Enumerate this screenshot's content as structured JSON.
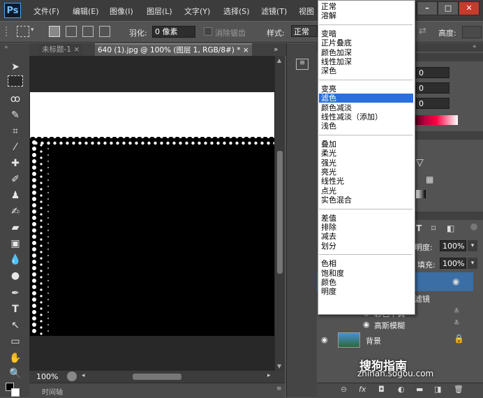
{
  "app": {
    "logo": "Ps"
  },
  "menu": [
    "文件(F)",
    "编辑(E)",
    "图像(I)",
    "图层(L)",
    "文字(Y)",
    "选择(S)",
    "滤镜(T)",
    "视图"
  ],
  "window_controls": {
    "minimize": "–",
    "maximize": "□",
    "close": "✕"
  },
  "options_bar": {
    "feather_label": "羽化:",
    "feather_value": "0 像素",
    "antialias_label": "消除锯齿",
    "style_label": "样式:",
    "style_value": "正常",
    "height_label": "高度:"
  },
  "tabs": [
    {
      "label": "未标题-1",
      "close": "×"
    },
    {
      "label": "640 (1).jpg @ 100% (图层 1, RGB/8#) *",
      "close": "×"
    }
  ],
  "tab_overflow": "»",
  "status": {
    "zoom": "100%"
  },
  "timeline_label": "时间轴",
  "blend_dropdown": {
    "groups": [
      [
        "正常",
        "溶解"
      ],
      [
        "变暗",
        "正片叠底",
        "颜色加深",
        "线性加深",
        "深色"
      ],
      [
        "变亮",
        "滤色",
        "颜色减淡",
        "线性减淡（添加）",
        "浅色"
      ],
      [
        "叠加",
        "柔光",
        "强光",
        "亮光",
        "线性光",
        "点光",
        "实色混合"
      ],
      [
        "差值",
        "排除",
        "减去",
        "划分"
      ],
      [
        "色相",
        "饱和度",
        "颜色",
        "明度"
      ]
    ],
    "selected": "滤色"
  },
  "color_panel": {
    "values": [
      "0",
      "0",
      "0"
    ]
  },
  "layers_panel": {
    "opacity_label": "明度:",
    "opacity_value": "100%",
    "fill_label": "填充:",
    "fill_value": "100%",
    "filter_label": "滤镜",
    "effects": [
      "彩色半调",
      "高斯模糊"
    ],
    "layer_name": "背景"
  },
  "watermark": {
    "text": "搜狗指南",
    "url": "zhinan.sogou.com"
  },
  "colors": {
    "accent": "#2a6fdb",
    "panel": "#535353",
    "dark": "#3c3c3c"
  }
}
